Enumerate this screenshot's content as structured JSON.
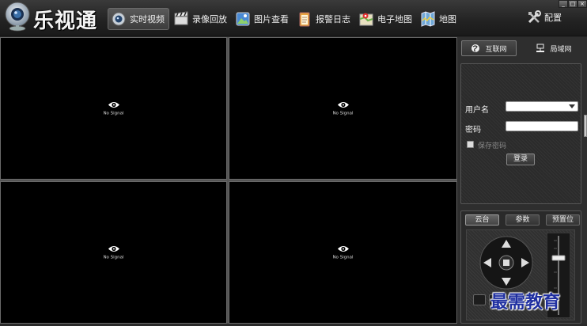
{
  "app": {
    "title": "乐视通"
  },
  "nav": [
    {
      "label": "实时视频",
      "icon": "camera-icon",
      "active": true
    },
    {
      "label": "录像回放",
      "icon": "film-icon",
      "active": false
    },
    {
      "label": "图片查看",
      "icon": "picture-icon",
      "active": false
    },
    {
      "label": "报警日志",
      "icon": "log-icon",
      "active": false
    },
    {
      "label": "电子地图",
      "icon": "map-pin-icon",
      "active": false
    },
    {
      "label": "地图",
      "icon": "folded-map-icon",
      "active": false
    }
  ],
  "config": {
    "label": "配置",
    "icon": "tools-icon"
  },
  "window_controls": [
    "_",
    "□",
    "×"
  ],
  "video": {
    "cells": [
      {
        "status": "No Signal"
      },
      {
        "status": "No Signal"
      },
      {
        "status": "No Signal"
      },
      {
        "status": "No Signal"
      }
    ]
  },
  "net_tabs": [
    {
      "label": "互联网",
      "icon": "globe-icon",
      "active": true
    },
    {
      "label": "局域网",
      "icon": "lan-icon",
      "active": false
    }
  ],
  "login": {
    "username_label": "用户名",
    "username_value": "",
    "password_label": "密码",
    "password_value": "",
    "remember_label": "保存密码",
    "login_button": "登录"
  },
  "ptz_tabs": [
    {
      "label": "云台",
      "active": true
    },
    {
      "label": "参数",
      "active": false
    },
    {
      "label": "预置位",
      "active": false
    }
  ],
  "watermark": "最需教育",
  "colors": {
    "background": "#2a2a2a",
    "video_bg": "#000000",
    "watermark": "#1f2fa0"
  }
}
